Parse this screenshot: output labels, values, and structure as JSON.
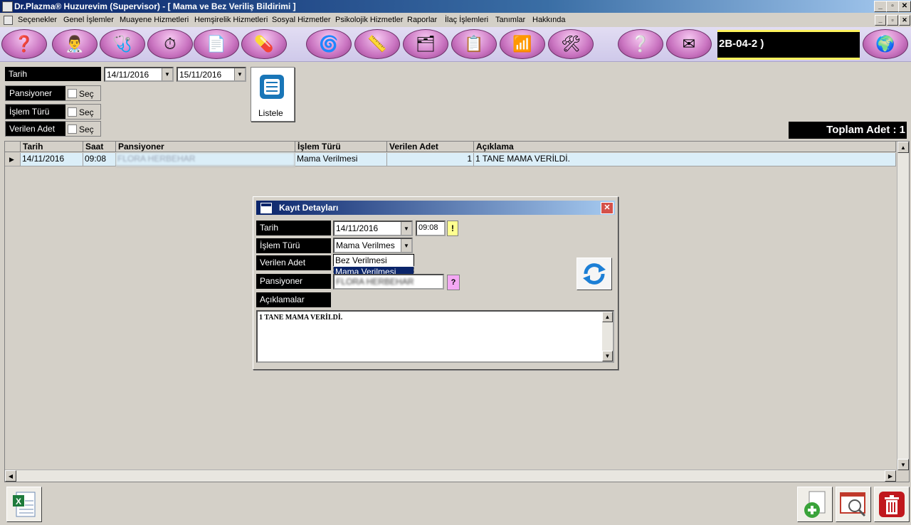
{
  "window": {
    "title": "Dr.Plazma® Huzurevim (Supervisor) - [ Mama ve Bez Veriliş Bildirimi ]",
    "minimize_glyph": "_",
    "restore_glyph": "▫",
    "close_glyph": "✕"
  },
  "menu": {
    "items": [
      "Seçenekler",
      "Genel İşlemler",
      "Muayene Hizmetleri",
      "Hemşirelik Hizmetleri",
      "Sosyal Hizmetler",
      "Psikolojik Hizmetler",
      "Raporlar",
      "İlaç İşlemleri",
      "Tanımlar",
      "Hakkında"
    ]
  },
  "toolbar": {
    "icons": [
      "help-head-icon",
      "doctors-icon",
      "stethoscope-icon",
      "compass-icon",
      "stopwatch-icon",
      "doc-icon",
      "pills-icon",
      "spiral-icon",
      "ruler-icon",
      "folder-icon",
      "clipboard-icon",
      "chart-icon",
      "tools-icon",
      "question-note-icon",
      "mail-icon",
      "globe-arrow-icon"
    ],
    "marquee_text": "2B-04-2 )"
  },
  "filters": {
    "tarih_label": "Tarih",
    "date_from": "14/11/2016",
    "date_to": "15/11/2016",
    "pansiyoner_label": "Pansiyoner",
    "islem_turu_label": "İşlem Türü",
    "verilen_adet_label": "Verilen Adet",
    "sec_label": "Seç",
    "listele_label": "Listele"
  },
  "summary": {
    "toplam": "Toplam Adet : 1"
  },
  "grid": {
    "columns": [
      "Tarih",
      "Saat",
      "Pansiyoner",
      "İşlem Türü",
      "Verilen Adet",
      "Açıklama"
    ],
    "rows": [
      {
        "tarih": "14/11/2016",
        "saat": "09:08",
        "pansiyoner": "FLORA HERBEHAR",
        "islem": "Mama Verilmesi",
        "adet": "1",
        "aciklama": "1 TANE MAMA VERİLDİ."
      }
    ]
  },
  "dialog": {
    "title": "Kayıt Detayları",
    "tarih_label": "Tarih",
    "islem_turu_label": "İşlem Türü",
    "verilen_adet_label": "Verilen Adet",
    "pansiyoner_label": "Pansiyoner",
    "aciklamalar_label": "Açıklamalar",
    "date": "14/11/2016",
    "time": "09:08",
    "time_btn": "!",
    "islem_value": "Mama Verilmes",
    "dropdown_options": [
      "Bez Verilmesi",
      "Mama Verilmesi"
    ],
    "selected_option": "Mama Verilmesi",
    "pansiyoner_value": "FLORA HERBEHAR",
    "pansiyoner_btn": "?",
    "aciklama_text": "1 TANE MAMA VERİLDİ."
  },
  "colors": {
    "title_start": "#0a246a",
    "grid_row": "#dbeef8",
    "toolbar_btn": "#c973c0"
  }
}
